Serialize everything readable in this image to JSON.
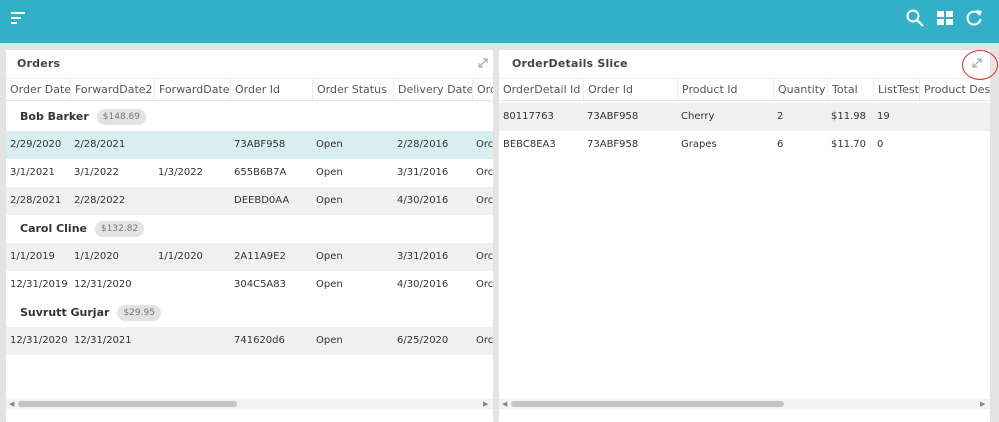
{
  "app": {
    "accent": "#33b0c8"
  },
  "appbar": {
    "menu_icon": "menu-icon",
    "search_icon": "search-icon",
    "grid_icon": "grid-icon",
    "refresh_icon": "refresh-icon"
  },
  "orders": {
    "title": "Orders",
    "columns": [
      "Order Date",
      "ForwardDate2",
      "ForwardDate",
      "Order Id",
      "Order Status",
      "Delivery Date",
      "Ord"
    ],
    "groups": [
      {
        "name": "Bob Barker",
        "total": "$148.69",
        "rows": [
          [
            "2/29/2020",
            "2/28/2021",
            "",
            "73ABF958",
            "Open",
            "2/28/2016",
            "Orc"
          ],
          [
            "3/1/2021",
            "3/1/2022",
            "1/3/2022",
            "655B6B7A",
            "Open",
            "3/31/2016",
            "Orc"
          ],
          [
            "2/28/2021",
            "2/28/2022",
            "",
            "DEEBD0AA",
            "Open",
            "4/30/2016",
            "Orc"
          ]
        ]
      },
      {
        "name": "Carol Cline",
        "total": "$132.82",
        "rows": [
          [
            "1/1/2019",
            "1/1/2020",
            "1/1/2020",
            "2A11A9E2",
            "Open",
            "3/31/2016",
            "Orc"
          ],
          [
            "12/31/2019",
            "12/31/2020",
            "",
            "304C5A83",
            "Open",
            "4/30/2016",
            "Orc"
          ]
        ]
      },
      {
        "name": "Suvrutt Gurjar",
        "total": "$29.95",
        "rows": [
          [
            "12/31/2020",
            "12/31/2021",
            "",
            "741620d6",
            "Open",
            "6/25/2020",
            "Orc"
          ]
        ]
      }
    ]
  },
  "details": {
    "title": "OrderDetails Slice",
    "columns": [
      "OrderDetail Id",
      "Order Id",
      "Product Id",
      "Quantity",
      "Total",
      "ListTest",
      "Product Des"
    ],
    "rows": [
      [
        "80117763",
        "73ABF958",
        "Cherry",
        "2",
        "$11.98",
        "19",
        ""
      ],
      [
        "BEBC8EA3",
        "73ABF958",
        "Grapes",
        "6",
        "$11.70",
        "0",
        ""
      ]
    ]
  }
}
